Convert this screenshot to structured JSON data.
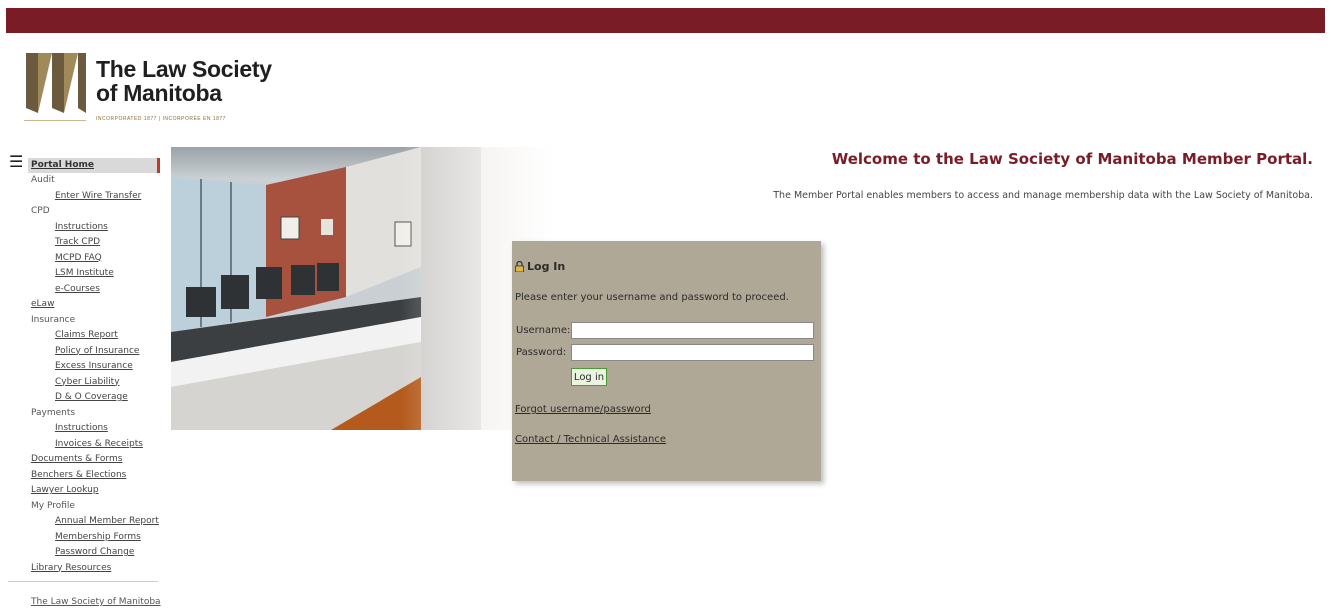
{
  "header": {
    "logo_title_line1": "The Law Society",
    "logo_title_line2": "of Manitoba",
    "logo_subtitle": "INCORPORATED 1877 | INCORPORÉE EN 1877"
  },
  "colors": {
    "brand": "#7a1c26",
    "login_panel": "#b0a896",
    "login_button": "#eaf5e0"
  },
  "icons": {
    "menu": "hamburger-menu-icon",
    "lock": "lock-icon"
  },
  "sidebar": {
    "home": "Portal Home",
    "sections": [
      {
        "label": "Audit",
        "type": "cat",
        "items": [
          "Enter Wire Transfer"
        ]
      },
      {
        "label": "CPD",
        "type": "cat",
        "items": [
          "Instructions",
          "Track CPD",
          "MCPD FAQ",
          "LSM Institute",
          "e-Courses"
        ]
      },
      {
        "label": "eLaw",
        "type": "link",
        "items": []
      },
      {
        "label": "Insurance",
        "type": "cat",
        "items": [
          "Claims Report",
          "Policy of Insurance",
          "Excess Insurance",
          "Cyber Liability",
          "D & O Coverage"
        ]
      },
      {
        "label": "Payments",
        "type": "cat",
        "items": [
          "Instructions",
          "Invoices & Receipts"
        ]
      },
      {
        "label": "Documents & Forms",
        "type": "link",
        "items": []
      },
      {
        "label": "Benchers & Elections",
        "type": "link",
        "items": []
      },
      {
        "label": "Lawyer Lookup",
        "type": "link",
        "items": []
      },
      {
        "label": "My Profile",
        "type": "cat",
        "items": [
          "Annual Member Report",
          "Membership Forms",
          "Password Change"
        ]
      },
      {
        "label": "Library Resources",
        "type": "link",
        "items": []
      }
    ],
    "footer": "The Law Society of Manitoba"
  },
  "welcome": {
    "title": "Welcome to the Law Society of Manitoba Member Portal.",
    "text": "The Member Portal enables members to access and manage membership data with the Law Society of Manitoba."
  },
  "login": {
    "heading": "Log In",
    "intro": "Please enter your username and password to proceed.",
    "username_label": "Username:",
    "password_label": "Password:",
    "username_value": "",
    "password_value": "",
    "button": "Log in",
    "forgot": "Forgot username/password",
    "contact": "Contact / Technical Assistance"
  }
}
